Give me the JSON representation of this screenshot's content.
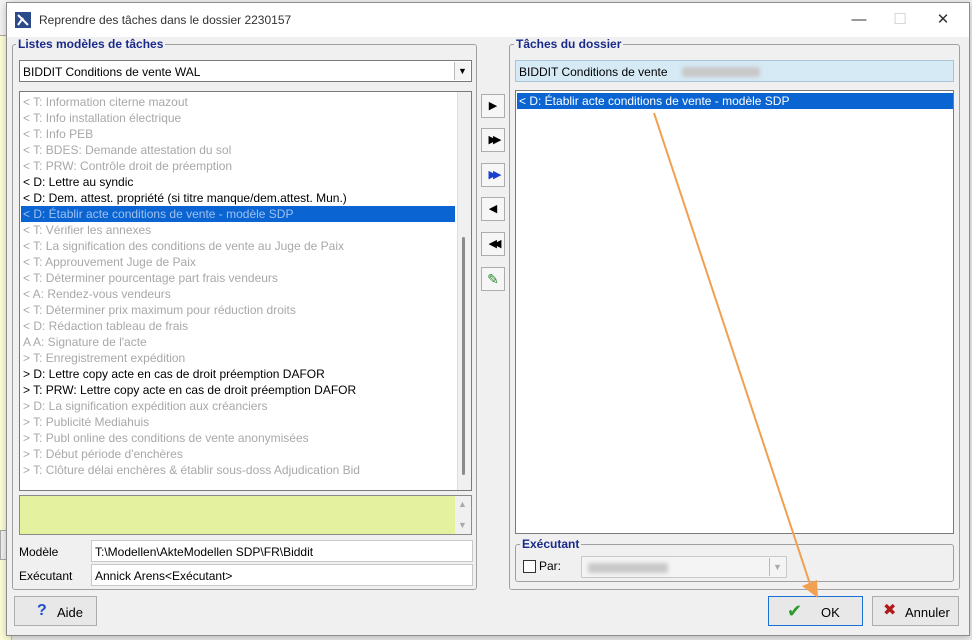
{
  "window": {
    "title": "Reprendre des tâches dans le dossier 2230157"
  },
  "left_panel": {
    "group_title": "Listes modèles de tâches",
    "combo_value": "BIDDIT Conditions de vente WAL",
    "items": [
      {
        "text": "< T: Information citerne mazout",
        "state": "grey"
      },
      {
        "text": "< T: Info installation électrique",
        "state": "grey"
      },
      {
        "text": "< T: Info PEB",
        "state": "grey"
      },
      {
        "text": "< T: BDES: Demande attestation du sol",
        "state": "grey"
      },
      {
        "text": "< T: PRW: Contrôle droit de préemption",
        "state": "grey"
      },
      {
        "text": "< D: Lettre au syndic",
        "state": "normal"
      },
      {
        "text": "< D: Dem. attest. propriété (si titre manque/dem.attest. Mun.)",
        "state": "normal"
      },
      {
        "text": "< D: Établir acte conditions de vente - modèle SDP",
        "state": "selected"
      },
      {
        "text": "< T: Vérifier les annexes",
        "state": "grey"
      },
      {
        "text": "< T: La signification des conditions de vente au Juge de Paix",
        "state": "grey"
      },
      {
        "text": "< T: Approuvement Juge de Paix",
        "state": "grey"
      },
      {
        "text": "< T: Déterminer pourcentage part frais vendeurs",
        "state": "grey"
      },
      {
        "text": "< A: Rendez-vous vendeurs",
        "state": "grey"
      },
      {
        "text": "< T: Déterminer prix maximum pour réduction droits",
        "state": "grey"
      },
      {
        "text": "< D: Rédaction tableau de frais",
        "state": "grey"
      },
      {
        "text": "A A: Signature de l'acte",
        "state": "grey"
      },
      {
        "text": "> T: Enregistrement expédition",
        "state": "grey"
      },
      {
        "text": "> D: Lettre copy acte en cas de droit préemption DAFOR",
        "state": "normal"
      },
      {
        "text": "> T: PRW: Lettre copy acte en cas de droit préemption DAFOR",
        "state": "normal"
      },
      {
        "text": "> D: La signification expédition aux créanciers",
        "state": "grey"
      },
      {
        "text": "> T: Publicité Mediahuis",
        "state": "grey"
      },
      {
        "text": "> T: Publ online des conditions de vente anonymisées",
        "state": "grey"
      },
      {
        "text": "> T: Début période d'enchères",
        "state": "grey"
      },
      {
        "text": "> T: Clôture délai enchères & établir sous-doss Adjudication Bid",
        "state": "grey"
      }
    ],
    "modele_label": "Modèle",
    "modele_value": "T:\\Modellen\\AkteModellen SDP\\FR\\Biddit",
    "executant_label": "Exécutant",
    "executant_value": "Annick Arens<Exécutant>"
  },
  "transfer_buttons": {
    "move_right": "▶",
    "move_all_right": "▶▶",
    "move_all_right_blue": "▶▶",
    "move_left": "◀",
    "move_all_left": "◀◀",
    "edit": "✎"
  },
  "right_panel": {
    "group_title": "Tâches du dossier",
    "header_value": "BIDDIT Conditions de vente",
    "items": [
      {
        "text": "< D: Établir acte conditions de vente - modèle SDP",
        "state": "selected"
      }
    ],
    "executant_group_title": "Exécutant",
    "par_label": "Par:"
  },
  "buttons": {
    "help": "Aide",
    "ok": "OK",
    "cancel": "Annuler"
  },
  "colors": {
    "selection": "#0a64d2",
    "group_title": "#1a2a8a",
    "note_bg": "#e4f2a0",
    "annotation_arrow": "#f0a050"
  }
}
